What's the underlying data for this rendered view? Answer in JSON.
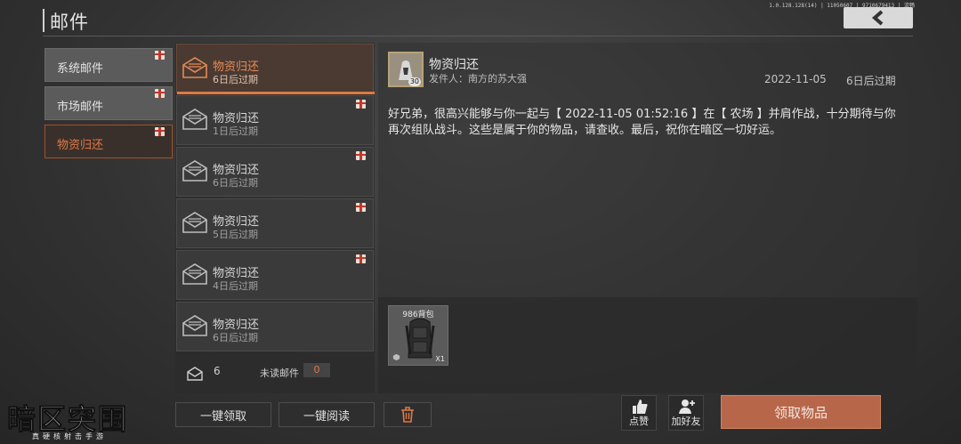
{
  "header": {
    "title": "邮件",
    "version": "1.0.128.128(14) | 11050607 | 9710679413 | 流畅"
  },
  "categories": [
    {
      "label": "系统邮件",
      "active": false
    },
    {
      "label": "市场邮件",
      "active": false
    },
    {
      "label": "物资归还",
      "active": true
    }
  ],
  "mails": [
    {
      "title": "物资归还",
      "expire": "6日后过期"
    },
    {
      "title": "物资归还",
      "expire": "1日后过期"
    },
    {
      "title": "物资归还",
      "expire": "6日后过期"
    },
    {
      "title": "物资归还",
      "expire": "5日后过期"
    },
    {
      "title": "物资归还",
      "expire": "4日后过期"
    },
    {
      "title": "物资归还",
      "expire": "6日后过期"
    }
  ],
  "summary": {
    "count": "6",
    "unread_label": "未读邮件",
    "unread_count": "0"
  },
  "list_actions": {
    "claim_all": "一键领取",
    "read_all": "一键阅读"
  },
  "detail": {
    "title": "物资归还",
    "sender": "发件人：南方的苏大强",
    "avatar_level": "30",
    "date": "2022-11-05",
    "expire": "6日后过期",
    "body": "好兄弟，很高兴能够与你一起与【 2022-11-05 01:52:16 】在【 农场 】并肩作战，十分期待与你再次组队战斗。这些是属于你的物品，请查收。最后，祝你在暗区一切好运。"
  },
  "attachment": {
    "name": "986背包",
    "qty": "X1"
  },
  "actions": {
    "like": "点赞",
    "add_friend": "加好友",
    "claim": "领取物品"
  },
  "logo": {
    "main": "暗区突围",
    "sub": "真硬核射击手游"
  },
  "colors": {
    "accent": "#e07845",
    "claim_button": "#b8664a"
  }
}
